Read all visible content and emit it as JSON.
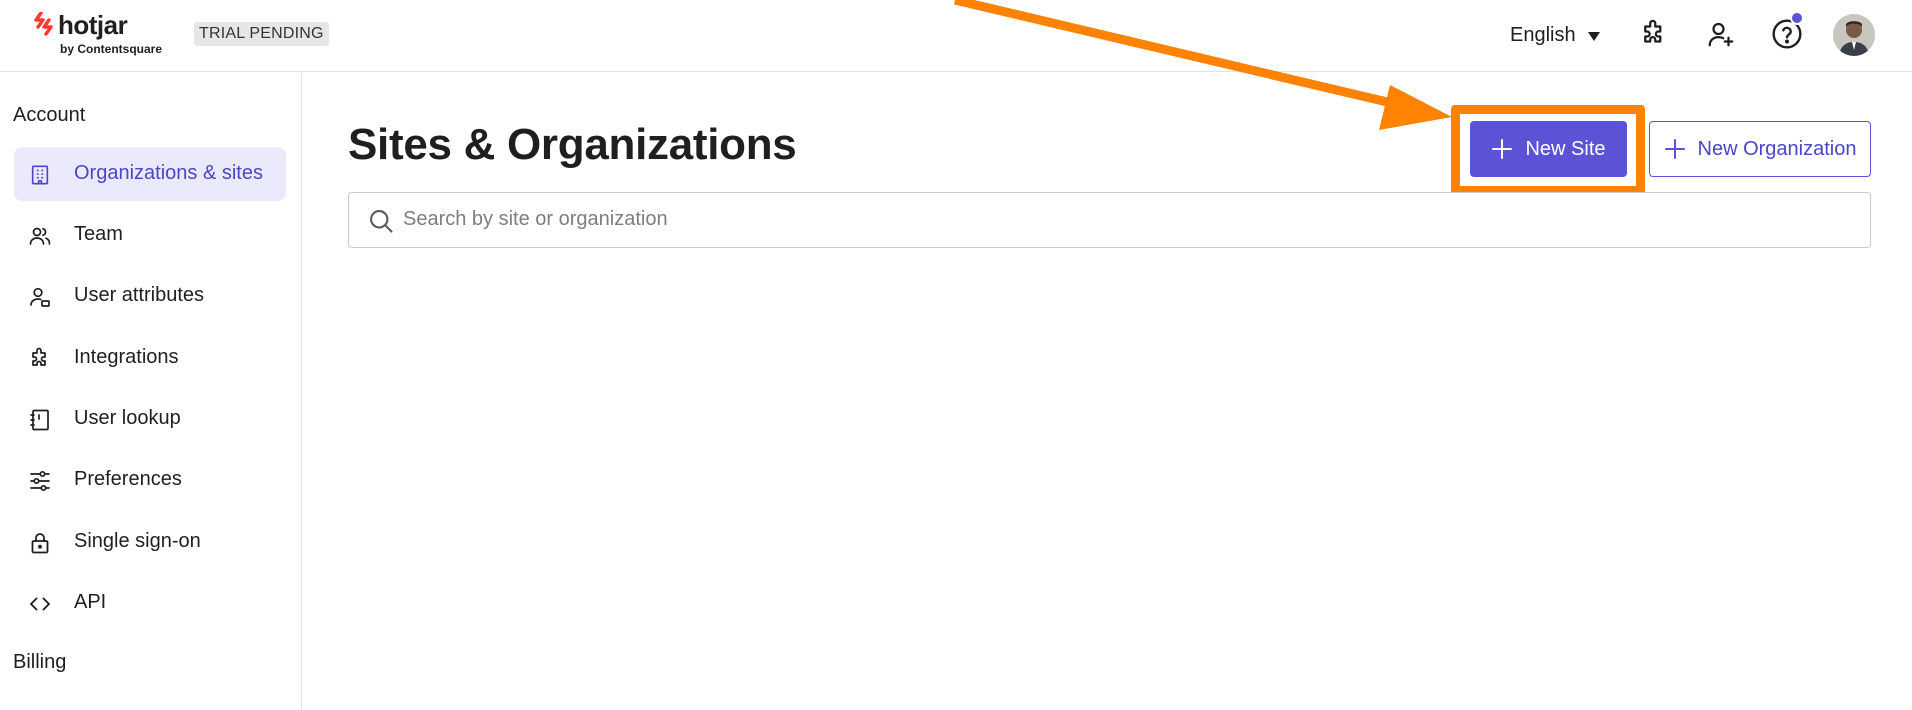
{
  "header": {
    "logo_text": "hotjar",
    "logo_subtext": "by Contentsquare",
    "trial_badge": "TRIAL PENDING",
    "language": "English",
    "icons": [
      "integrations-icon",
      "invite-user-icon",
      "help-icon",
      "avatar"
    ],
    "has_notification": true
  },
  "sidebar": {
    "sections": [
      {
        "title": "Account",
        "items": [
          {
            "label": "Organizations & sites",
            "icon": "building-icon",
            "active": true
          },
          {
            "label": "Team",
            "icon": "team-icon",
            "active": false
          },
          {
            "label": "User attributes",
            "icon": "user-attributes-icon",
            "active": false
          },
          {
            "label": "Integrations",
            "icon": "puzzle-icon",
            "active": false
          },
          {
            "label": "User lookup",
            "icon": "notebook-icon",
            "active": false
          },
          {
            "label": "Preferences",
            "icon": "sliders-icon",
            "active": false
          },
          {
            "label": "Single sign-on",
            "icon": "lock-icon",
            "active": false
          },
          {
            "label": "API",
            "icon": "code-icon",
            "active": false
          }
        ]
      },
      {
        "title": "Billing",
        "items": []
      }
    ]
  },
  "main": {
    "title": "Sites & Organizations",
    "new_site_label": "New Site",
    "new_org_label": "New Organization",
    "search_placeholder": "Search by site or organization",
    "search_value": ""
  },
  "colors": {
    "accent": "#5b52d6",
    "accent_active_bg": "#ebeafd",
    "annotation_orange": "#ff8200",
    "brand_red": "#fd3a2f"
  }
}
